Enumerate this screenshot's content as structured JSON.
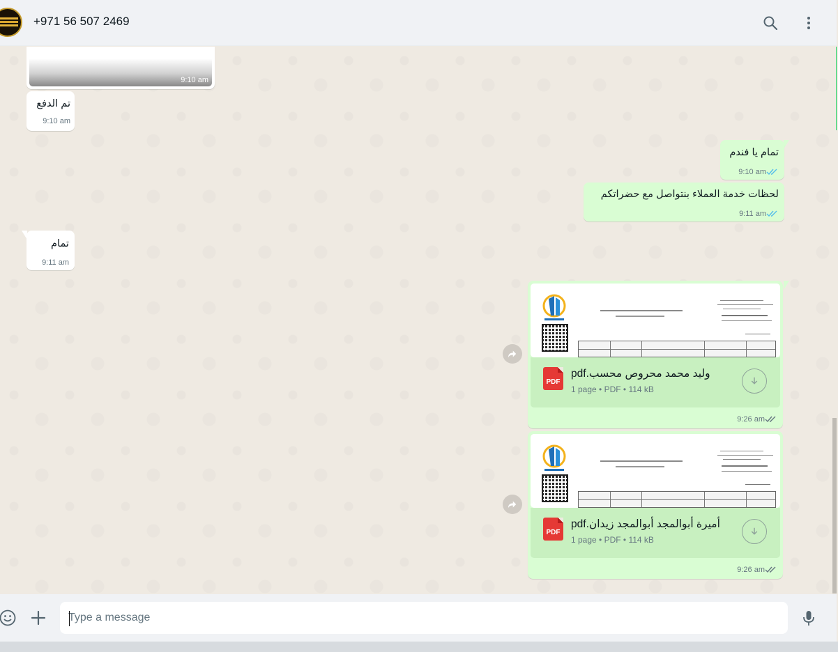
{
  "header": {
    "contact_name": "+971 56 507 2469",
    "icons": [
      "search-icon",
      "menu-dots-icon"
    ]
  },
  "messages": {
    "image": {
      "time": "9:10 am"
    },
    "m1": {
      "text": "تم الدفع",
      "time": "9:10 am"
    },
    "m2": {
      "text": "تمام يا فندم",
      "time": "9:10 am",
      "status": "read"
    },
    "m3": {
      "text": "لحظات خدمة العملاء بنتواصل مع حضراتكم",
      "time": "9:11 am",
      "status": "read"
    },
    "m4": {
      "text": "تمام",
      "time": "9:11 am"
    },
    "doc1": {
      "filename": "وليد محمد محروص محسب.pdf",
      "meta": "1 page • PDF • 114 kB",
      "time": "9:26 am",
      "icon_label": "PDF",
      "status": "delivered"
    },
    "doc2": {
      "filename": "أميرة أبوالمجد أبوالمجد زيدان.pdf",
      "meta": "1 page • PDF • 114 kB",
      "time": "9:26 am",
      "icon_label": "PDF",
      "status": "delivered"
    }
  },
  "composer": {
    "placeholder": "Type a message"
  },
  "colors": {
    "incoming": "#ffffff",
    "outgoing": "#d9fdd3",
    "read_ticks": "#53bdeb",
    "delivered_ticks": "#667781",
    "pdf": "#e53935"
  }
}
